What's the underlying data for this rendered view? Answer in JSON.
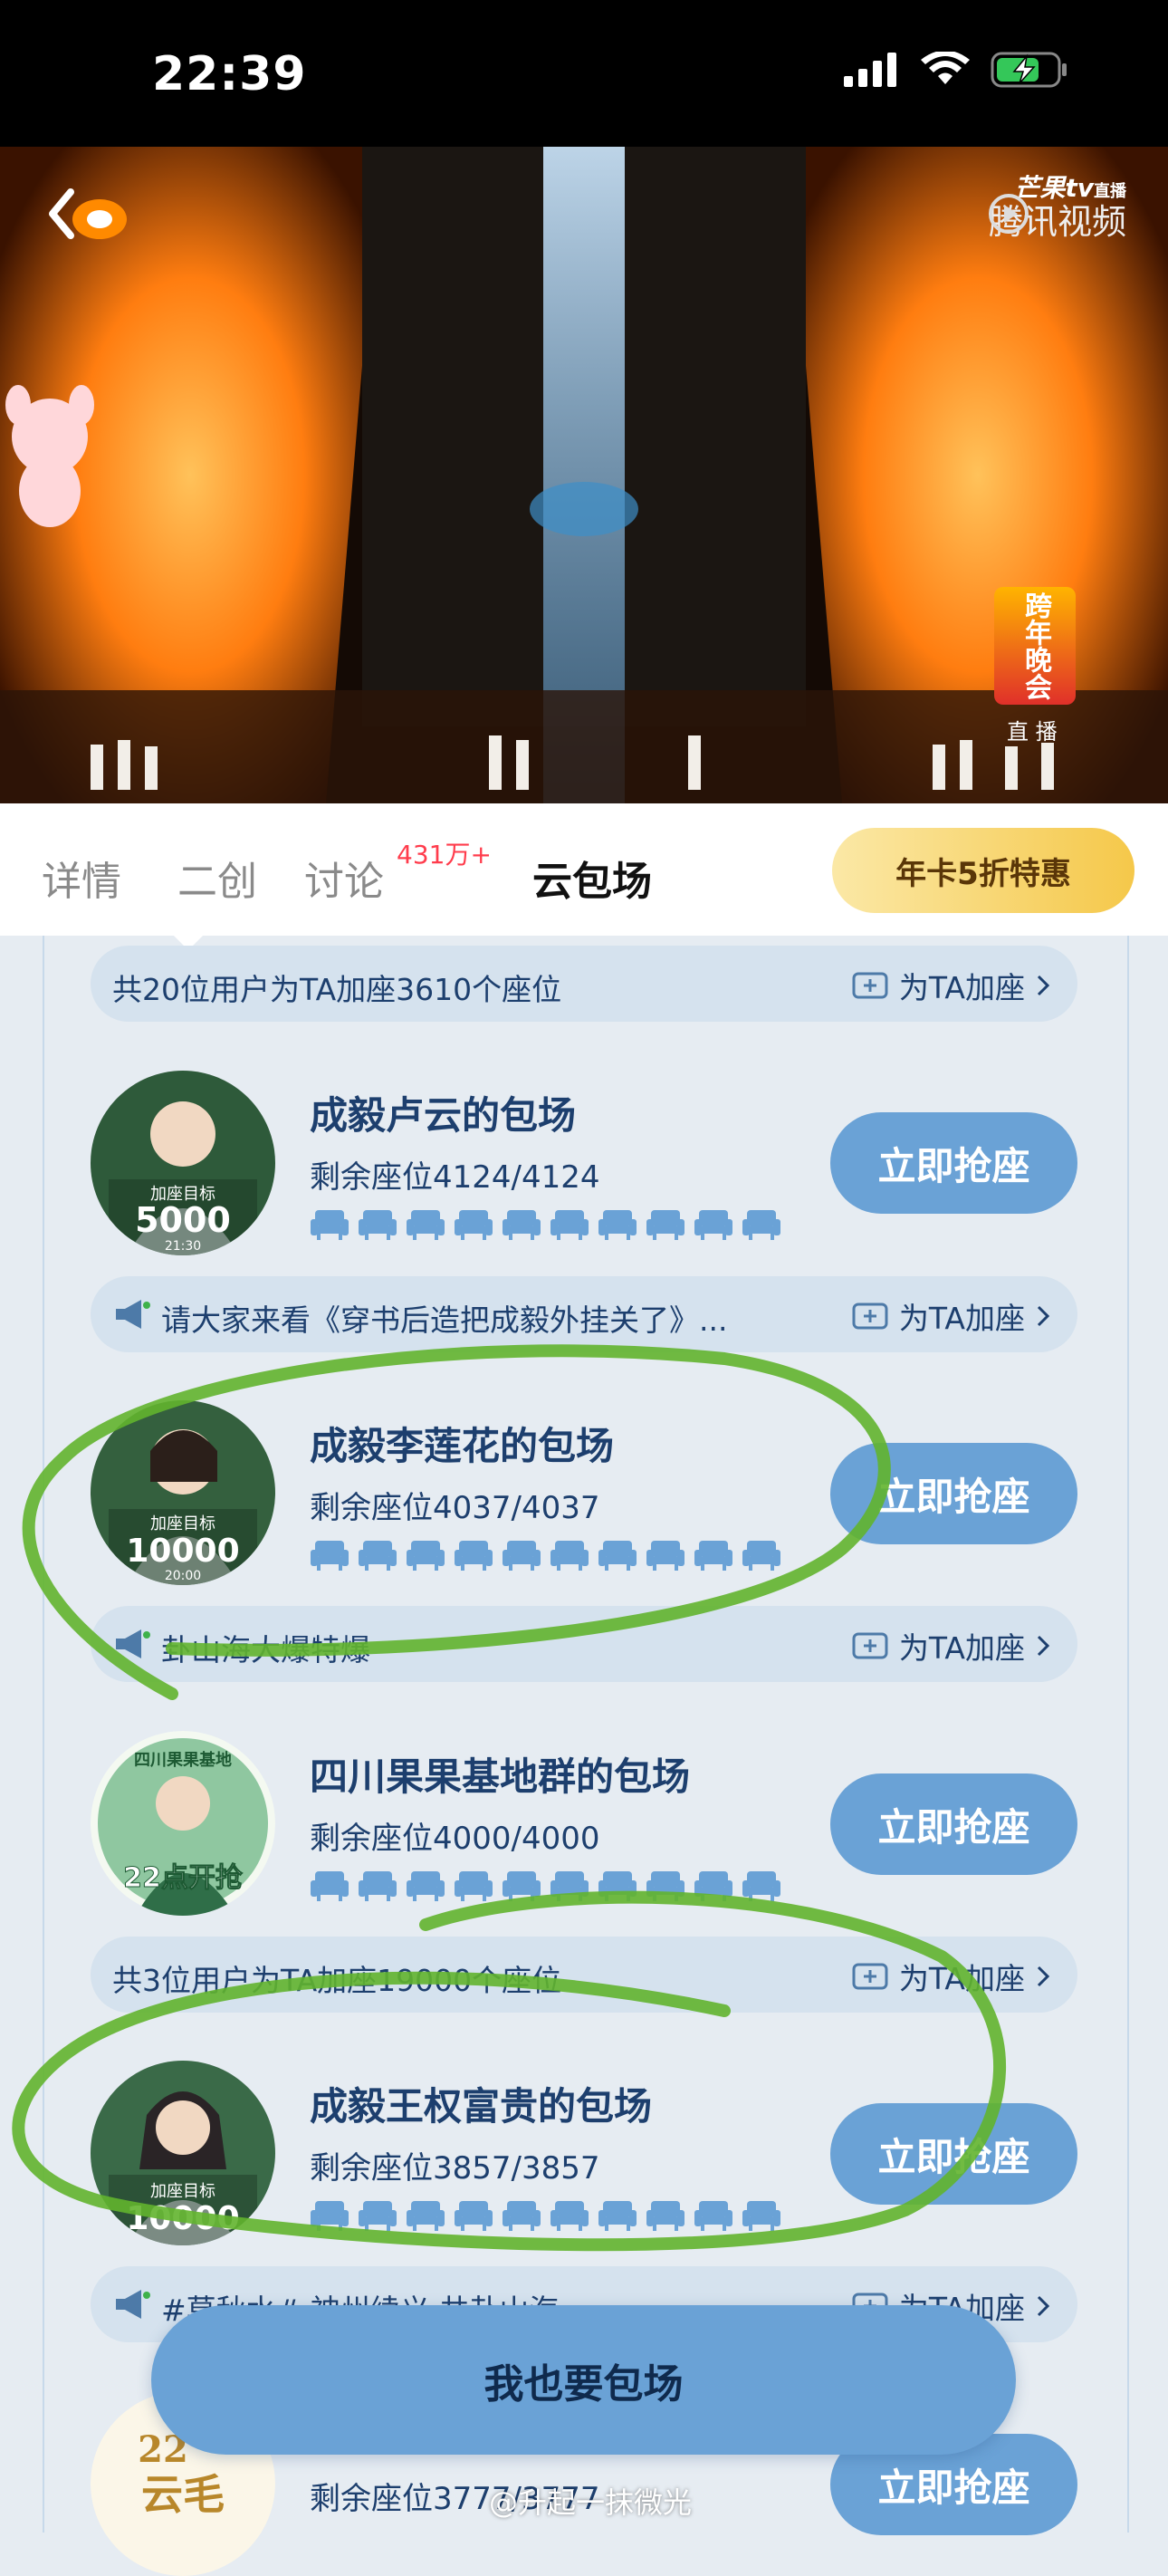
{
  "status_bar": {
    "time": "22:39"
  },
  "video": {
    "watermark_top": "芒果tv",
    "watermark_live_small": "直播",
    "watermark_platform": "腾讯视频",
    "show_logo": "跨年晚会",
    "live_label": "直 播",
    "colors": {
      "stage_light": "#ff8a1c",
      "beam": "#9bd2ff"
    }
  },
  "tabs": [
    {
      "label": "详情"
    },
    {
      "label": "二创"
    },
    {
      "label": "讨论",
      "badge": "431万+"
    },
    {
      "label": "云包场"
    }
  ],
  "promo_button": "年卡5折特惠",
  "info_bars": [
    {
      "text": "共20位用户为TA加座3610个座位",
      "action": "为TA加座"
    },
    {
      "text": "请大家来看《穿书后造把成毅外挂关了》...",
      "action": "为TA加座"
    },
    {
      "text": "卦山海大爆特爆",
      "action": "为TA加座"
    },
    {
      "text": "共3位用户为TA加座19000个座位",
      "action": "为TA加座"
    },
    {
      "text": "#莫秋水# 神州续义 共卦山海",
      "action": "为TA加座"
    }
  ],
  "cards": [
    {
      "title": "成毅卢云的包场",
      "seats": "剩余座位4124/4124",
      "avatar_goal_label": "加座目标",
      "avatar_goal": "5000",
      "avatar_time": "21:30",
      "button": "立即抢座"
    },
    {
      "title": "成毅李莲花的包场",
      "seats": "剩余座位4037/4037",
      "avatar_goal_label": "加座目标",
      "avatar_goal": "10000",
      "avatar_time": "20:00",
      "button": "立即抢座"
    },
    {
      "title": "四川果果基地群的包场",
      "seats": "剩余座位4000/4000",
      "avatar_goal_label": "四川果果基地",
      "avatar_goal": "22点开抢",
      "avatar_time": "",
      "button": "立即抢座"
    },
    {
      "title": "成毅王权富贵的包场",
      "seats": "剩余座位3857/3857",
      "avatar_goal_label": "加座目标",
      "avatar_goal": "10000",
      "avatar_time": "",
      "button": "立即抢座"
    },
    {
      "title": "",
      "seats": "剩余座位3777/3777",
      "avatar_goal_label": "云毛",
      "avatar_goal": "22",
      "avatar_time": "",
      "button": "立即抢座"
    }
  ],
  "cta_button": "我也要包场",
  "watermark_bottom": "@升起一抹微光",
  "colors": {
    "accent": "#6aa2d6",
    "text_blue": "#1d3f6e",
    "badge_red": "#ff3c4c",
    "annotation_green": "#62b42e"
  }
}
